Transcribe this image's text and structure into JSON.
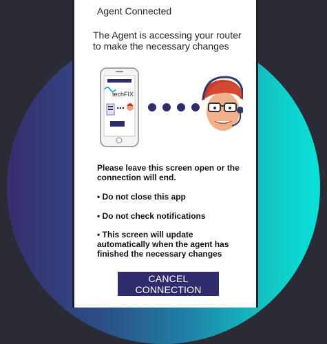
{
  "header": {
    "title": "Agent Connected"
  },
  "main": {
    "description": "The Agent is accessing your router to make the necessary changes",
    "brand": {
      "logo_text": "techFIX",
      "accent": "#2ba9d8"
    },
    "messages": {
      "warning": "Please leave this screen open or the connection will end.",
      "bullet_1": "• Do not close this app",
      "bullet_2": "• Do not check notifications",
      "bullet_3": "• This screen will update automatically when the agent has finished the necessary changes"
    },
    "cancel_label": "CANCEL CONNECTION"
  },
  "colors": {
    "button_bg": "#2f2c6e",
    "dots": "#2f2c6e",
    "page_bg": "#2b2b36"
  }
}
